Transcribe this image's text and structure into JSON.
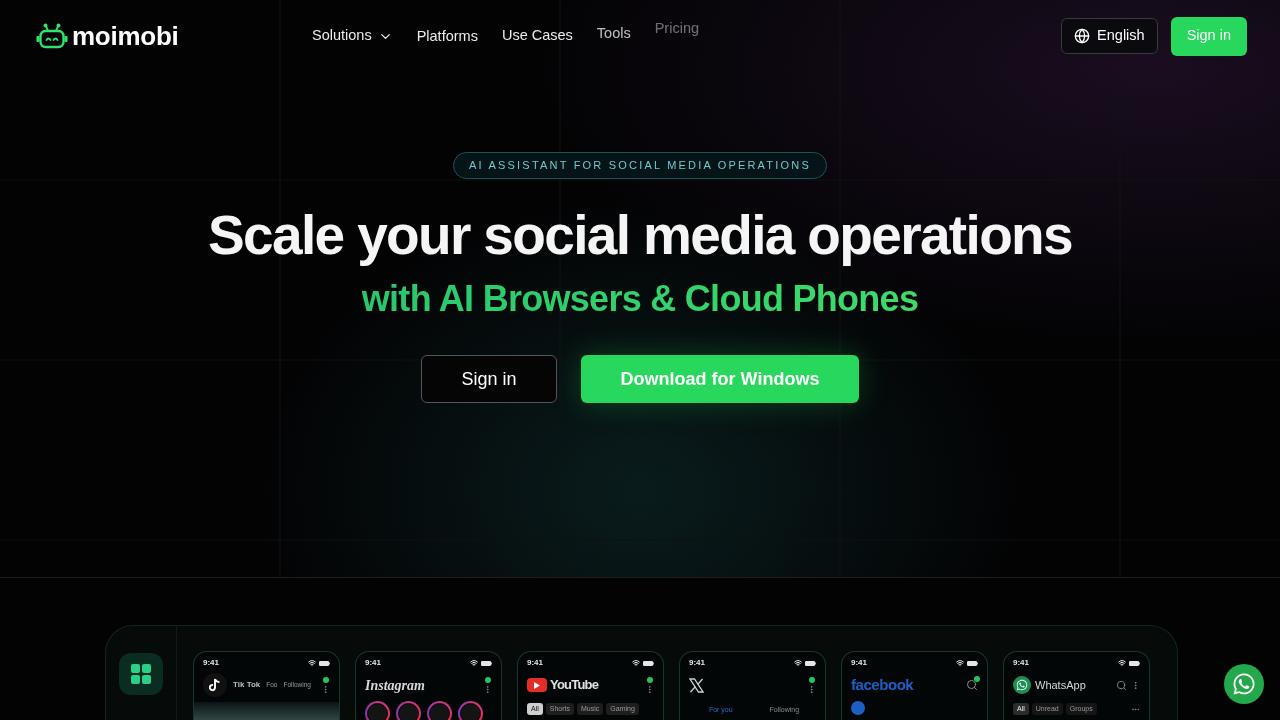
{
  "header": {
    "logo": "moimobi",
    "nav": [
      {
        "label": "Solutions",
        "dropdown": true
      },
      {
        "label": "Platforms",
        "dropdown": false
      },
      {
        "label": "Use Cases",
        "dropdown": false
      },
      {
        "label": "Tools",
        "dropdown": false
      },
      {
        "label": "Pricing",
        "dropdown": false
      }
    ],
    "language": "English",
    "sign_in": "Sign in"
  },
  "hero": {
    "badge": "AI ASSISTANT FOR SOCIAL MEDIA OPERATIONS",
    "title": "Scale your social media operations",
    "subtitle": "with AI Browsers & Cloud Phones",
    "buttons": [
      {
        "label": "Sign in",
        "kind": "outline"
      },
      {
        "label": "Download for Windows",
        "kind": "primary"
      }
    ]
  },
  "preview": {
    "phones": [
      {
        "kind": "tiktok",
        "time": "9:41",
        "app": "Tik Tok",
        "notification": true,
        "labels": [
          "Foo",
          "Following"
        ]
      },
      {
        "kind": "instagram",
        "time": "9:41",
        "app": "Instagram",
        "notification": true
      },
      {
        "kind": "youtube",
        "time": "9:41",
        "app": "YouTube",
        "notification": true,
        "chips": [
          {
            "label": "All",
            "selected": true
          },
          {
            "label": "Shorts",
            "selected": false
          },
          {
            "label": "Music",
            "selected": false
          },
          {
            "label": "Gaming",
            "selected": false
          }
        ]
      },
      {
        "kind": "x",
        "time": "9:41",
        "notification": true,
        "tabs": [
          {
            "label": "For you",
            "selected": true
          },
          {
            "label": "Following",
            "selected": false
          }
        ]
      },
      {
        "kind": "facebook",
        "time": "9:41",
        "app": "facebook",
        "notification": true
      },
      {
        "kind": "whatsapp",
        "time": "9:41",
        "app": "WhatsApp",
        "notification": false,
        "chips": [
          {
            "label": "All",
            "selected": true
          },
          {
            "label": "Unread",
            "selected": false
          },
          {
            "label": "Groups",
            "selected": false
          }
        ]
      }
    ]
  }
}
